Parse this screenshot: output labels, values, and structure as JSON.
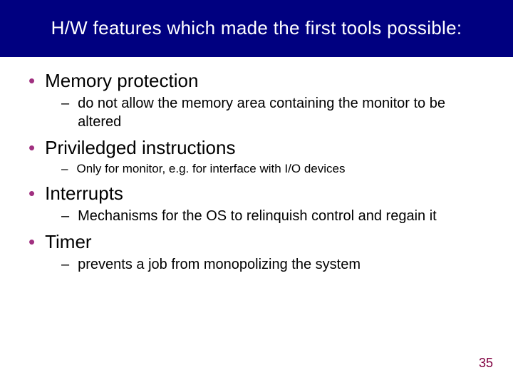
{
  "title": "H/W features which made the first tools possible:",
  "bullets": [
    {
      "text": "Memory protection",
      "subs": [
        {
          "text": "do not allow the memory area containing the monitor to be altered",
          "small": false
        }
      ]
    },
    {
      "text": "Priviledged instructions",
      "subs": [
        {
          "text": "Only for monitor, e.g. for interface with I/O devices",
          "small": true
        }
      ]
    },
    {
      "text": "Interrupts",
      "subs": [
        {
          "text": "Mechanisms for the OS to relinquish control and regain it",
          "small": false
        }
      ]
    },
    {
      "text": "Timer",
      "subs": [
        {
          "text": "prevents a job from monopolizing the system",
          "small": false
        }
      ]
    }
  ],
  "page_number": "35"
}
